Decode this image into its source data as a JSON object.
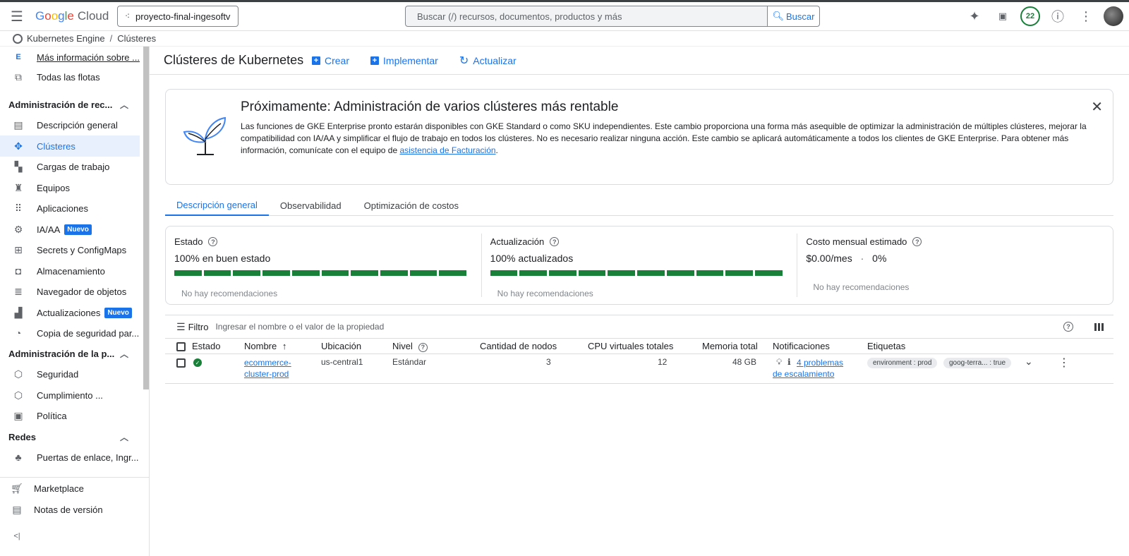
{
  "topbar": {
    "logo_g": "G",
    "logo_o1": "o",
    "logo_o2": "o",
    "logo_g2": "g",
    "logo_l": "l",
    "logo_e": "e",
    "logo_cloud": "Cloud",
    "project": "proyecto-final-ingesoftv",
    "search_placeholder": "Buscar (/) recursos, documentos, productos y más",
    "search_button": "Buscar",
    "notifications_count": "22"
  },
  "breadcrumb": {
    "product": "Kubernetes Engine",
    "page": "Clústeres",
    "separator": "/"
  },
  "sidebar": {
    "top_items": [
      {
        "label": "Más información sobre ...",
        "icon": "e-icon"
      },
      {
        "label": "Todas las flotas",
        "icon": "fleets-icon"
      }
    ],
    "section1": "Administración de rec...",
    "section1_items": [
      {
        "label": "Descripción general"
      },
      {
        "label": "Clústeres"
      },
      {
        "label": "Cargas de trabajo"
      },
      {
        "label": "Equipos"
      },
      {
        "label": "Aplicaciones"
      },
      {
        "label": "IA/AA",
        "badge": "Nuevo"
      },
      {
        "label": "Secrets y ConfigMaps"
      },
      {
        "label": "Almacenamiento"
      },
      {
        "label": "Navegador de objetos"
      },
      {
        "label": "Actualizaciones",
        "badge": "Nuevo"
      },
      {
        "label": "Copia de seguridad par..."
      }
    ],
    "section2": "Administración de la p...",
    "section2_items": [
      {
        "label": "Seguridad"
      },
      {
        "label": "Cumplimiento ..."
      },
      {
        "label": "Política"
      }
    ],
    "section3": "Redes",
    "section3_items": [
      {
        "label": "Puertas de enlace, Ingr..."
      }
    ],
    "bottom_items": [
      {
        "label": "Marketplace"
      },
      {
        "label": "Notas de versión"
      }
    ],
    "collapse_glyph": "<|"
  },
  "main": {
    "title": "Clústeres de Kubernetes",
    "actions": {
      "create": "Crear",
      "deploy": "Implementar",
      "refresh": "Actualizar"
    },
    "banner": {
      "title": "Próximamente: Administración de varios clústeres más rentable",
      "body": "Las funciones de GKE Enterprise pronto estarán disponibles con GKE Standard o como SKU independientes. Este cambio proporciona una forma más asequible de optimizar la administración de múltiples clústeres, mejorar la compatibilidad con IA/AA y simplificar el flujo de trabajo en todos los clústeres. No es necesario realizar ninguna acción. Este cambio se aplicará automáticamente a todos los clientes de GKE Enterprise. Para obtener más información, comunícate con el equipo de ",
      "link": "asistencia de Facturación",
      "suffix": "."
    },
    "tabs": [
      "Descripción general",
      "Observabilidad",
      "Optimización de costos"
    ],
    "stats": {
      "estado": {
        "label": "Estado",
        "value": "100% en buen estado",
        "rec": "No hay recomendaciones",
        "healthy_fraction": 1.0
      },
      "actualizacion": {
        "label": "Actualización",
        "value": "100% actualizados",
        "rec": "No hay recomendaciones",
        "updated_fraction": 1.0
      },
      "costo": {
        "label": "Costo mensual estimado",
        "value": "$0.00/mes",
        "dot": "·",
        "pct": "0%",
        "rec": "No hay recomendaciones"
      }
    },
    "filter": {
      "label": "Filtro",
      "placeholder": "Ingresar el nombre o el valor de la propiedad"
    },
    "table": {
      "headers": [
        "Estado",
        "Nombre",
        "Ubicación",
        "Nivel",
        "Cantidad de nodos",
        "CPU virtuales totales",
        "Memoria total",
        "Notificaciones",
        "Etiquetas"
      ],
      "sort_arrow": "↑",
      "rows": [
        {
          "name_line1": "ecommerce-",
          "name_line2": "cluster-prod",
          "location": "us-central1",
          "tier": "Estándar",
          "nodes": "3",
          "vcpus": "12",
          "memory": "48 GB",
          "notif_line1": "4 problemas",
          "notif_line2": "de escalamiento",
          "label1": "environment : prod",
          "label2": "goog-terra... : true"
        }
      ]
    }
  },
  "colors": {
    "accent": "#1a73e8",
    "success": "#188038"
  }
}
